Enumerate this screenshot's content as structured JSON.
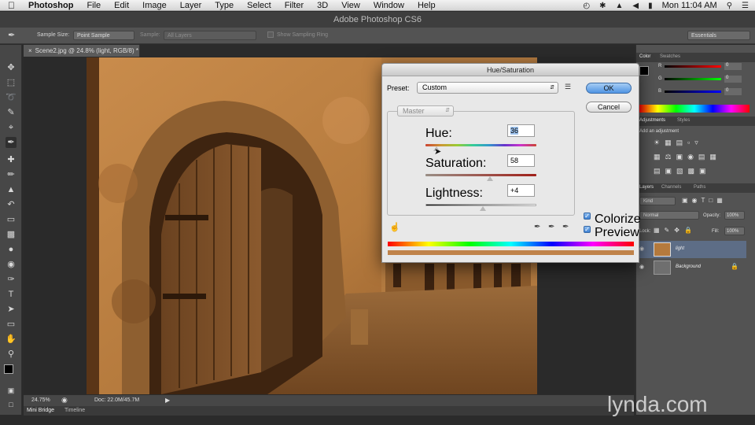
{
  "menubar": {
    "apple_icon": "apple-icon",
    "items": [
      "Photoshop",
      "File",
      "Edit",
      "Image",
      "Layer",
      "Type",
      "Select",
      "Filter",
      "3D",
      "View",
      "Window",
      "Help"
    ],
    "clock": "Mon 11:04 AM"
  },
  "window": {
    "title": "Adobe Photoshop CS6"
  },
  "options": {
    "sample_size_label": "Sample Size:",
    "sample_size_value": "Point Sample",
    "sample_label": "Sample:",
    "sample_value": "All Layers",
    "sampling_ring_label": "Show Sampling Ring",
    "workspace": "Essentials"
  },
  "document": {
    "tab_label": "Scene2.jpg @ 24.8% (light, RGB/8) *",
    "zoom": "24.75%",
    "doc_size": "Doc: 22.0M/45.7M"
  },
  "bottom_tabs": [
    "Mini Bridge",
    "Timeline"
  ],
  "dialog": {
    "title": "Hue/Saturation",
    "preset_label": "Preset:",
    "preset_value": "Custom",
    "channel": "Master",
    "hue_label": "Hue:",
    "hue_value": "36",
    "saturation_label": "Saturation:",
    "saturation_value": "58",
    "lightness_label": "Lightness:",
    "lightness_value": "+4",
    "ok_label": "OK",
    "cancel_label": "Cancel",
    "colorize_label": "Colorize",
    "preview_label": "Preview",
    "hue_slider_fraction": 0.1,
    "saturation_slider_fraction": 0.58,
    "lightness_slider_fraction": 0.52
  },
  "color_panel": {
    "tabs": [
      "Color",
      "Swatches"
    ],
    "channels": [
      {
        "label": "R",
        "value": "0"
      },
      {
        "label": "G",
        "value": "0"
      },
      {
        "label": "B",
        "value": "0"
      }
    ]
  },
  "adjustments_panel": {
    "tabs": [
      "Adjustments",
      "Styles"
    ],
    "heading": "Add an adjustment"
  },
  "layers_panel": {
    "tabs": [
      "Layers",
      "Channels",
      "Paths"
    ],
    "filter_kind": "Kind",
    "blend_mode": "Normal",
    "opacity_label": "Opacity:",
    "opacity_value": "100%",
    "lock_label": "Lock:",
    "fill_label": "Fill:",
    "fill_value": "100%",
    "layers": [
      {
        "name": "light"
      },
      {
        "name": "Background"
      }
    ]
  },
  "watermark": "lynda.com",
  "colors": {
    "sepia_light": "#c2874a",
    "sepia_dark": "#4a2a12",
    "photo_tint": "#b87a3c"
  }
}
